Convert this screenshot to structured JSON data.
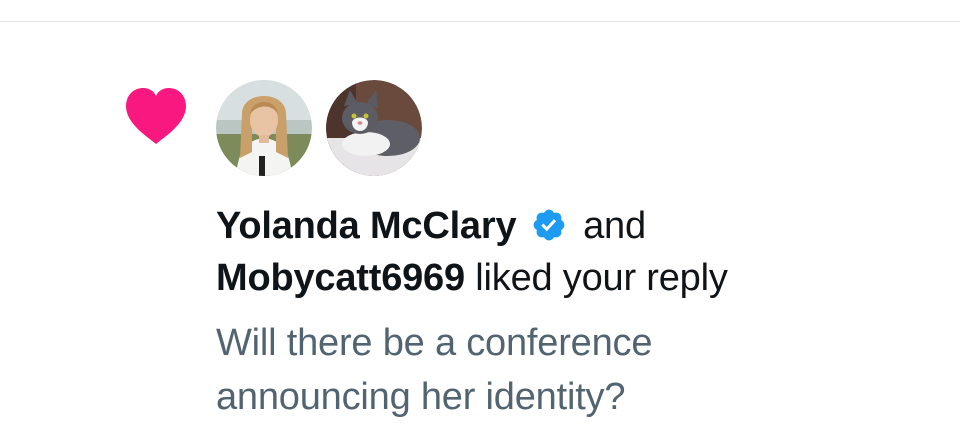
{
  "notification": {
    "type": "like",
    "users": [
      {
        "name": "Yolanda McClary",
        "verified": true,
        "avatar": "woman-avatar"
      },
      {
        "name": "Mobycatt6969",
        "verified": false,
        "avatar": "cat-avatar"
      }
    ],
    "conjunction": "and",
    "action_text": "liked your reply",
    "reply_text_line1": "Will there be a conference",
    "reply_text_line2": "announcing her identity?"
  },
  "colors": {
    "heart": "#f91880",
    "verified": "#1d9bf0",
    "primary_text": "#0f1419",
    "secondary_text": "#536471",
    "divider": "#dfe3e6"
  },
  "icons": {
    "heart": "heart-icon",
    "verified": "verified-badge-icon"
  }
}
